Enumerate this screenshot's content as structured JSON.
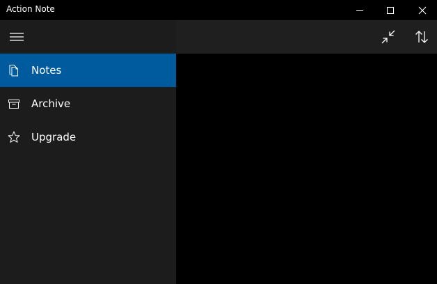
{
  "window": {
    "title": "Action Note"
  },
  "caption_buttons": {
    "minimize_icon": "minimize-icon",
    "maximize_icon": "maximize-icon",
    "close_icon": "close-icon"
  },
  "pane": {
    "menu_icon": "hamburger-icon",
    "items": [
      {
        "label": "Notes",
        "icon": "notes-icon",
        "selected": true
      },
      {
        "label": "Archive",
        "icon": "archive-icon",
        "selected": false
      },
      {
        "label": "Upgrade",
        "icon": "star-icon",
        "selected": false
      }
    ]
  },
  "command_bar": {
    "collapse_icon": "collapse-icon",
    "sort_icon": "sort-icon"
  },
  "colors": {
    "selected_accent": "#005a9e",
    "pane_background": "#1c1c1c",
    "content_background": "#000000"
  }
}
